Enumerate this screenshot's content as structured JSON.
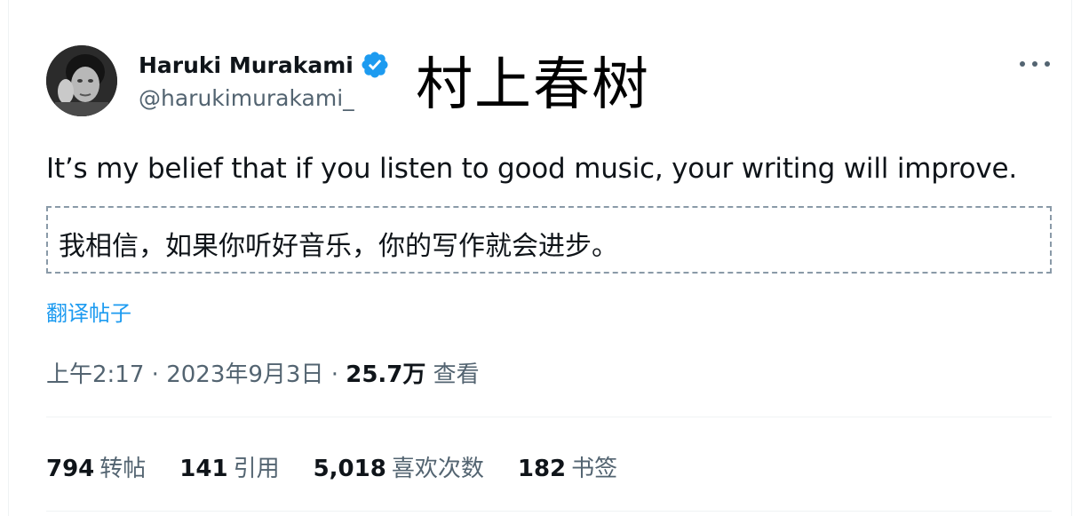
{
  "author": {
    "display_name": "Haruki Murakami",
    "handle": "@harukimurakami_",
    "overlay_name": "村上春树"
  },
  "tweet": {
    "text": "It’s my belief that if you listen to good music, your writing will improve.",
    "translation": "我相信，如果你听好音乐，你的写作就会进步。",
    "translate_link": "翻译帖子"
  },
  "meta": {
    "time": "上午2:17",
    "sep1": " · ",
    "date": "2023年9月3日",
    "sep2": " · ",
    "views_count": "25.7万",
    "views_label": " 查看"
  },
  "stats": [
    {
      "value": "794",
      "label": "转帖"
    },
    {
      "value": "141",
      "label": "引用"
    },
    {
      "value": "5,018",
      "label": "喜欢次数"
    },
    {
      "value": "182",
      "label": "书签"
    }
  ],
  "colors": {
    "accent": "#1d9bf0",
    "secondary_text": "#536471",
    "primary_text": "#0f1419",
    "divider": "#eff3f4"
  },
  "icons": {
    "verified": "verified-badge-icon",
    "more": "more-options-icon"
  }
}
